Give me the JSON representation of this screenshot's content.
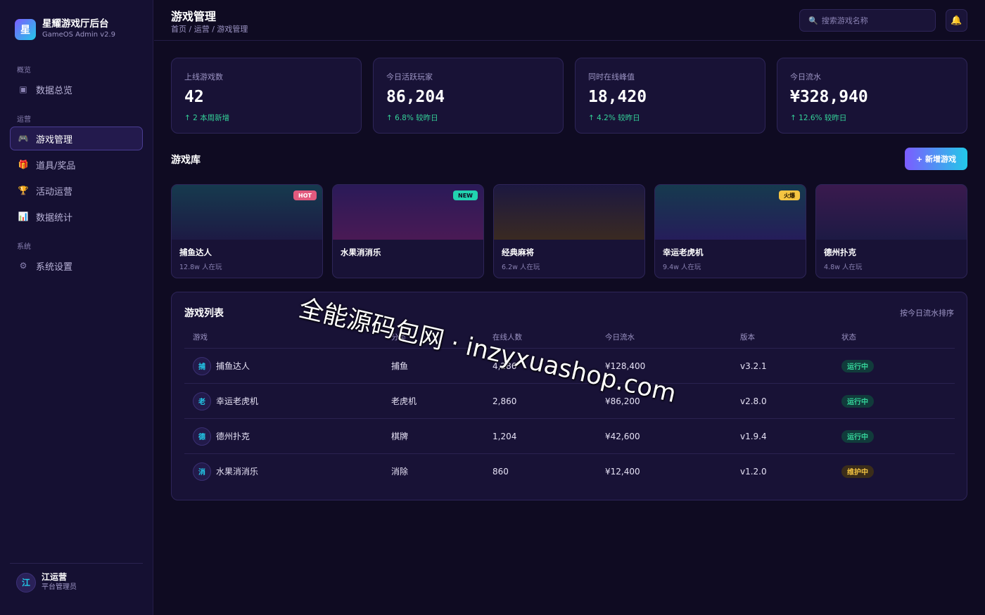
{
  "brand": {
    "logo_char": "星",
    "name": "星耀游戏厅后台",
    "subtitle": "GameOS Admin v2.9"
  },
  "sidebar": {
    "sections": [
      {
        "label": "概览"
      },
      {
        "label": "运营"
      },
      {
        "label": "系统"
      }
    ],
    "items": [
      {
        "label": "数据总览",
        "icon": "▣",
        "icon_name": "dashboard-icon"
      },
      {
        "label": "游戏管理",
        "icon": "🎮",
        "icon_name": "gamepad-icon",
        "active": true
      },
      {
        "label": "道具/奖品",
        "icon": "🎁",
        "icon_name": "gift-icon"
      },
      {
        "label": "活动运营",
        "icon": "🏆",
        "icon_name": "trophy-icon"
      },
      {
        "label": "数据统计",
        "icon": "📊",
        "icon_name": "chart-icon"
      },
      {
        "label": "系统设置",
        "icon": "⚙",
        "icon_name": "gear-icon"
      }
    ],
    "user": {
      "avatar_char": "江",
      "name": "江运营",
      "role": "平台管理员"
    }
  },
  "header": {
    "title": "游戏管理",
    "breadcrumb": "首页 / 运营 / 游戏管理",
    "search_placeholder": "搜索游戏名称",
    "search_icon": "search-icon",
    "bell_icon": "bell-icon"
  },
  "stats": [
    {
      "label": "上线游戏数",
      "value": "42",
      "change": "↑ 2 本周新增"
    },
    {
      "label": "今日活跃玩家",
      "value": "86,204",
      "change": "↑ 6.8% 较昨日"
    },
    {
      "label": "同时在线峰值",
      "value": "18,420",
      "change": "↑ 4.2% 较昨日"
    },
    {
      "label": "今日流水",
      "value": "¥328,940",
      "change": "↑ 12.6% 较昨日"
    }
  ],
  "library": {
    "title": "游戏库",
    "add_button": "+ 新增游戏",
    "games": [
      {
        "name": "捕鱼达人",
        "players": "12.8w 人在玩",
        "badge": "HOT",
        "badge_bg": "#e25a7e",
        "badge_fg": "#ffffff",
        "cover_from": "#163a4e",
        "cover_to": "#1d1a44"
      },
      {
        "name": "水果消消乐",
        "players": "",
        "badge": "NEW",
        "badge_bg": "#22d3b0",
        "badge_fg": "#0f0b22",
        "cover_from": "#2a1a58",
        "cover_to": "#4a1a55"
      },
      {
        "name": "经典麻将",
        "players": "6.2w 人在玩",
        "badge": "",
        "badge_bg": "",
        "badge_fg": "",
        "cover_from": "#1c1840",
        "cover_to": "#3a2a22"
      },
      {
        "name": "幸运老虎机",
        "players": "9.4w 人在玩",
        "badge": "火爆",
        "badge_bg": "#f5c542",
        "badge_fg": "#2a1a00",
        "cover_from": "#163a4e",
        "cover_to": "#251d5a"
      },
      {
        "name": "德州扑克",
        "players": "4.8w 人在玩",
        "badge": "",
        "badge_bg": "",
        "badge_fg": "",
        "cover_from": "#3a1a4e",
        "cover_to": "#1d1a44"
      }
    ]
  },
  "table": {
    "title": "游戏列表",
    "sort_label": "按今日流水排序",
    "headers": [
      "游戏",
      "分类",
      "在线人数",
      "今日流水",
      "版本",
      "状态"
    ],
    "rows": [
      {
        "avatar": "捕",
        "name": "捕鱼达人",
        "category": "捕鱼",
        "online": "4,286",
        "revenue": "¥128,400",
        "version": "v3.2.1",
        "status": "运行中",
        "status_type": "run"
      },
      {
        "avatar": "老",
        "name": "幸运老虎机",
        "category": "老虎机",
        "online": "2,860",
        "revenue": "¥86,200",
        "version": "v2.8.0",
        "status": "运行中",
        "status_type": "run"
      },
      {
        "avatar": "德",
        "name": "德州扑克",
        "category": "棋牌",
        "online": "1,204",
        "revenue": "¥42,600",
        "version": "v1.9.4",
        "status": "运行中",
        "status_type": "run"
      },
      {
        "avatar": "消",
        "name": "水果消消乐",
        "category": "消除",
        "online": "860",
        "revenue": "¥12,400",
        "version": "v1.2.0",
        "status": "维护中",
        "status_type": "maint"
      }
    ]
  },
  "watermark": "全能源码包网 · inzyxuashop.com",
  "colors": {
    "accent_purple": "#7c5cff",
    "accent_cyan": "#22c9e8",
    "success": "#34d399",
    "warning": "#f5c542",
    "background": "#0f0b22"
  }
}
